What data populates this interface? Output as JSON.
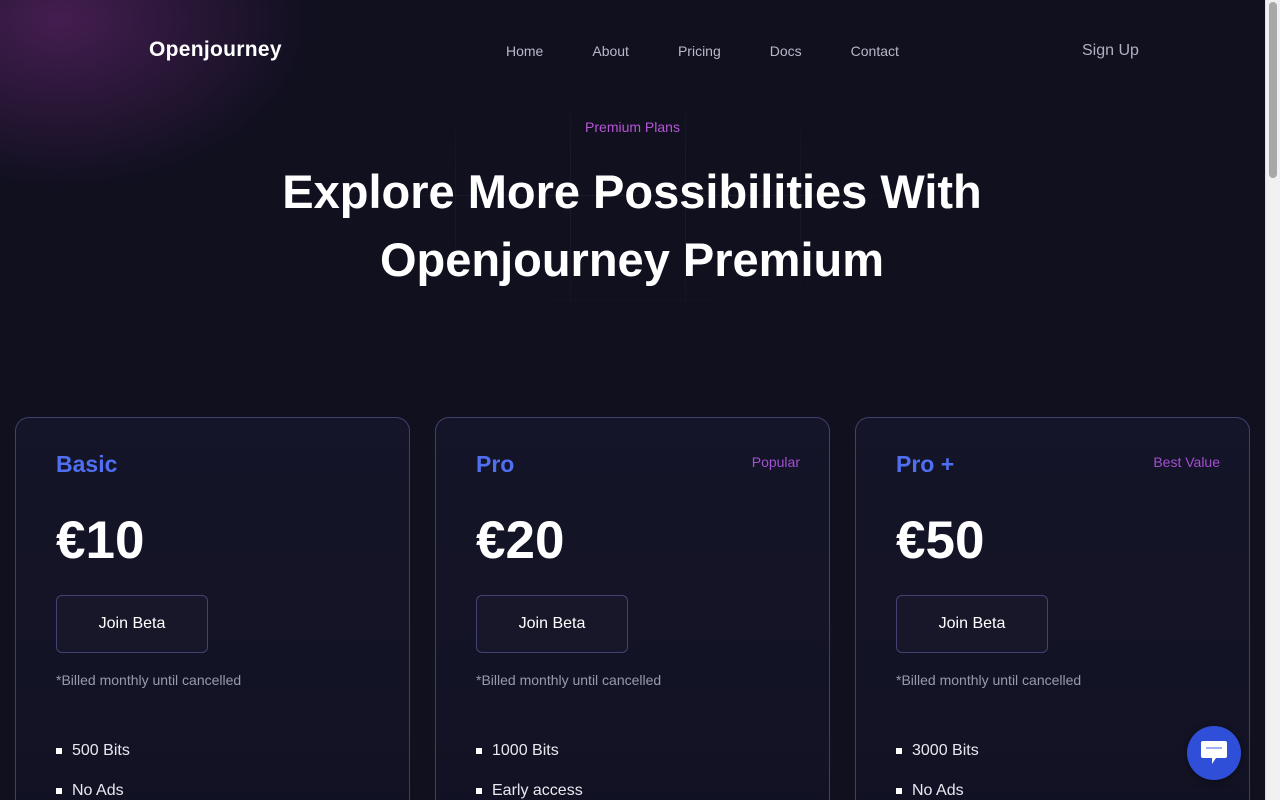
{
  "nav": {
    "logo": "Openjourney",
    "links": [
      "Home",
      "About",
      "Pricing",
      "Docs",
      "Contact"
    ],
    "signup": "Sign Up"
  },
  "hero": {
    "eyebrow": "Premium Plans",
    "title": "Explore More Possibilities With Openjourney Premium"
  },
  "plans": [
    {
      "name": "Basic",
      "tag": "",
      "price": "€10",
      "button": "Join Beta",
      "billing": "*Billed monthly until cancelled",
      "features": [
        "500 Bits",
        "No Ads"
      ]
    },
    {
      "name": "Pro",
      "tag": "Popular",
      "price": "€20",
      "button": "Join Beta",
      "billing": "*Billed monthly until cancelled",
      "features": [
        "1000 Bits",
        "Early access"
      ]
    },
    {
      "name": "Pro +",
      "tag": "Best Value",
      "price": "€50",
      "button": "Join Beta",
      "billing": "*Billed monthly until cancelled",
      "features": [
        "3000 Bits",
        "No Ads"
      ]
    }
  ],
  "chat": {
    "icon": "chat-bubble-icon"
  },
  "colors": {
    "background": "#10101f",
    "accent_blue": "#4f6ef0",
    "accent_purple": "#b655d6",
    "chat_button": "#2f4fd8"
  }
}
